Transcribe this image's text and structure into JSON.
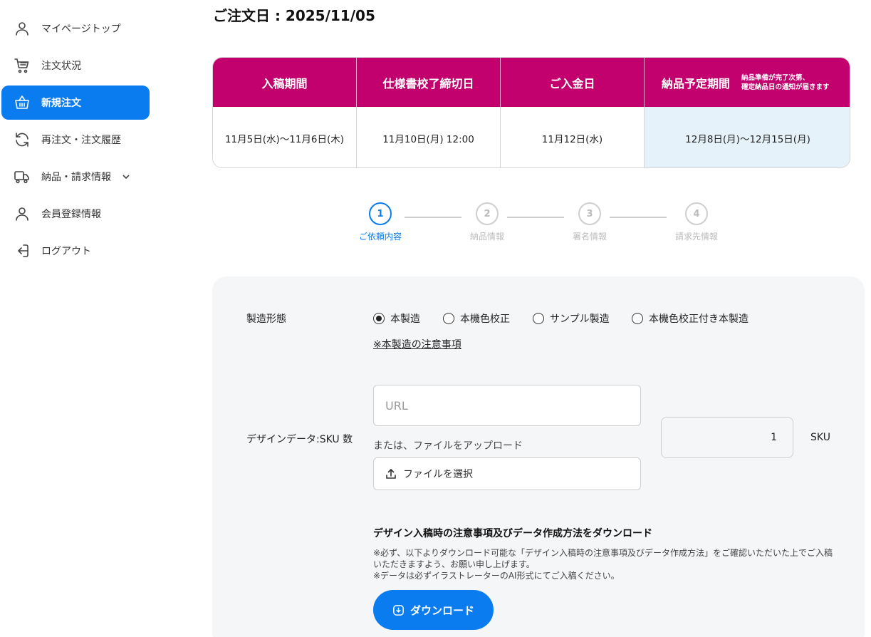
{
  "sidebar": {
    "items": [
      {
        "label": "マイページトップ",
        "icon": "user-icon"
      },
      {
        "label": "注文状況",
        "icon": "cart-icon"
      },
      {
        "label": "新規注文",
        "icon": "basket-icon",
        "active": true
      },
      {
        "label": "再注文・注文履歴",
        "icon": "refresh-icon"
      },
      {
        "label": "納品・請求情報",
        "icon": "truck-icon",
        "has_submenu": true
      },
      {
        "label": "会員登録情報",
        "icon": "user-icon"
      },
      {
        "label": "ログアウト",
        "icon": "logout-icon"
      }
    ]
  },
  "order_date": "ご注文日 : 2025/11/05",
  "schedule": {
    "headers": [
      "入稿期間",
      "仕様書校了締切日",
      "ご入金日",
      "納品予定期間"
    ],
    "delivery_note": [
      "納品準備が完了次第、",
      "確定納品日の通知が届きます"
    ],
    "values": [
      "11月5日(水)〜11月6日(木)",
      "11月10日(月) 12:00",
      "11月12日(水)",
      "12月8日(月)〜12月15日(月)"
    ],
    "header_color": "#c2006e",
    "highlight_color": "#e6f2fa"
  },
  "stepper": {
    "current": 1,
    "steps": [
      {
        "num": "1",
        "label": "ご依頼内容"
      },
      {
        "num": "2",
        "label": "納品情報"
      },
      {
        "num": "3",
        "label": "署名情報"
      },
      {
        "num": "4",
        "label": "請求先情報"
      }
    ]
  },
  "form": {
    "manufacturing_label": "製造形態",
    "options": [
      "本製造",
      "本機色校正",
      "サンプル製造",
      "本機色校正付き本製造"
    ],
    "selected_option": "本製造",
    "notice_link": "※本製造の注意事項",
    "design_label": "デザインデータ:SKU 数",
    "url_placeholder": "URL",
    "or_text": "または、ファイルをアップロード",
    "file_button": "ファイルを選択",
    "sku_value": "1",
    "sku_unit": "SKU",
    "download_title": "デザイン入稿時の注意事項及びデータ作成方法をダウンロード",
    "download_notes": [
      "※必ず、以下よりダウンロード可能な「デザイン入稿時の注意事項及びデータ作成方法」をご確認いただいた上でご入稿いただきますよう、お願い申し上げます。",
      "※データは必ずイラストレーターのAI形式にてご入稿ください。"
    ],
    "download_button": "ダウンロード"
  },
  "colors": {
    "accent": "#0a7cf0",
    "brand_magenta": "#c2006e",
    "panel_bg": "#f5f6f8"
  }
}
